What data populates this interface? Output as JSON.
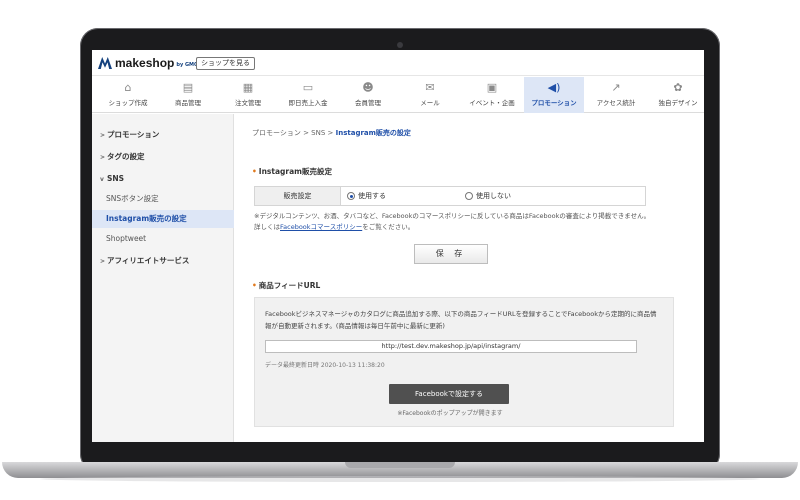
{
  "topbar": {
    "brand": "makeshop",
    "brand_sub": "by GMO",
    "view_shop_label": "ショップを見る"
  },
  "nav": {
    "items": [
      {
        "label": "ショップ作成",
        "icon": "shop-icon"
      },
      {
        "label": "商品管理",
        "icon": "basket-icon"
      },
      {
        "label": "注文管理",
        "icon": "clipboard-icon"
      },
      {
        "label": "即日売上入金",
        "icon": "folder-icon"
      },
      {
        "label": "会員管理",
        "icon": "users-icon"
      },
      {
        "label": "メール",
        "icon": "mail-icon"
      },
      {
        "label": "イベント・企画",
        "icon": "gift-icon"
      },
      {
        "label": "プロモーション",
        "icon": "megaphone-icon"
      },
      {
        "label": "アクセス統計",
        "icon": "chart-icon"
      },
      {
        "label": "独自デザイン",
        "icon": "palette-icon"
      }
    ],
    "active": "プロモーション"
  },
  "sidebar": {
    "items": [
      {
        "label": "プロモーション"
      },
      {
        "label": "タグの設定"
      },
      {
        "label": "SNS"
      },
      {
        "label": "SNSボタン設定"
      },
      {
        "label": "Instagram販売の設定"
      },
      {
        "label": "Shoptweet"
      },
      {
        "label": "アフィリエイトサービス"
      }
    ]
  },
  "breadcrumb": {
    "path": "プロモーション > SNS > ",
    "current": "Instagram販売の設定"
  },
  "instagram": {
    "section_title": "Instagram販売設定",
    "setting_label": "販売設定",
    "option_use": "使用する",
    "option_not_use": "使用しない",
    "selected": "使用する",
    "note_text": "※デジタルコンテンツ、お酒、タバコなど、Facebookのコマースポリシーに反している商品はFacebookの審査により掲載できません。詳しくは",
    "note_link": "Facebookコマースポリシー",
    "note_suffix": "をご覧ください。",
    "save_label": "保 存"
  },
  "feed": {
    "section_title": "商品フィードURL",
    "description": "Facebookビジネスマネージャのカタログに商品追加する際、以下の商品フィードURLを登録することでFacebookから定期的に商品情報が自動更新されます。(商品情報は毎日午前中に最新に更新)",
    "url": "http://test.dev.makeshop.jp/api/instagram/",
    "updated": "データ最終更新日時  2020-10-13 11:38:20",
    "fb_button": "Facebookで設定する",
    "popup_note": "※Facebookのポップアップが開きます"
  },
  "colors": {
    "accent": "#1f4fa8",
    "active_bg": "#dde6f6",
    "section_dot": "#e07a1f"
  }
}
